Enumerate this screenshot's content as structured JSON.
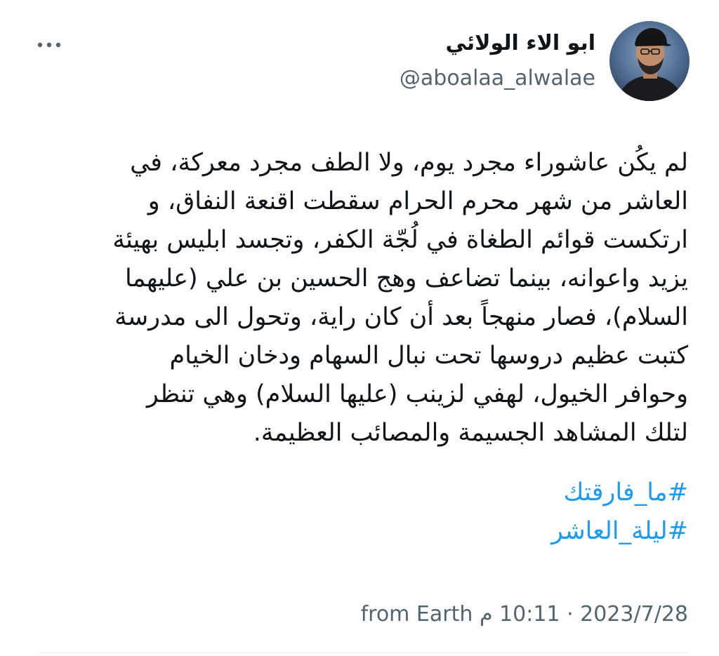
{
  "author": {
    "name": "ابو الاء الولائي",
    "handle": "@aboalaa_alwalae"
  },
  "tweet": {
    "lines": [
      "لم يكُن عاشوراء مجرد يوم، ولا الطف مجرد معركة، في",
      "العاشر من شهر محرم الحرام سقطت اقنعة النفاق، و",
      "ارتكست قوائم الطغاة في لُجّة الكفر، وتجسد ابليس بهيئة",
      "يزيد واعوانه، بينما تضاعف وهج الحسين بن علي (عليهما",
      "السلام)، فصار منهجاً بعد أن كان راية، وتحول الى مدرسة",
      "كتبت عظيم دروسها تحت نبال السهام ودخان الخيام",
      "وحوافر الخيول، لهفي لزينب (عليها السلام) وهي تنظر",
      "لتلك المشاهد الجسيمة والمصائب العظيمة."
    ],
    "hashtags": [
      "#ما_فارقتك",
      "#ليلة_العاشر"
    ]
  },
  "meta": {
    "date": "2023/7/28",
    "separator": "·",
    "time": "10:11 م",
    "location": "from Earth"
  },
  "icons": {
    "more": "more-horizontal-icon",
    "avatar": "profile-photo"
  },
  "colors": {
    "text": "#0f1419",
    "secondary": "#536471",
    "link": "#1d9bf0"
  }
}
